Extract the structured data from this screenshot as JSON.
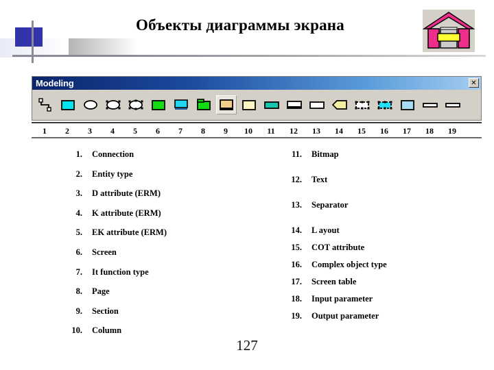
{
  "slide": {
    "title": "Объекты диаграммы экрана",
    "number": "127"
  },
  "logo": {
    "name": "house-logo",
    "roof_color": "#ee2d8c",
    "pillar_color": "#ee2d8c",
    "band_color": "#ffff33",
    "frame_color": "#000000",
    "background_color": "#d4d0c8"
  },
  "decoration": {
    "square_color": "#3333aa",
    "line_color": "#8a8a99"
  },
  "toolbar": {
    "title": "Modeling",
    "close_label": "✕",
    "background": "#d4d0c8",
    "titlebar_start": "#0a246a",
    "titlebar_end": "#a6cdf0",
    "selected_index": 9,
    "buttons": [
      {
        "n": "1",
        "icon": "connection-icon",
        "shape": "polyline"
      },
      {
        "n": "2",
        "icon": "entity-type-icon",
        "shape": "rect",
        "fill": "#00e5ee"
      },
      {
        "n": "3",
        "icon": "d-attribute-icon",
        "shape": "ellipse",
        "fill": "#ffffff"
      },
      {
        "n": "4",
        "icon": "k-attribute-icon",
        "shape": "ellipse-ticks",
        "fill": "#ffffff"
      },
      {
        "n": "5",
        "icon": "ek-attribute-icon",
        "shape": "ellipse-ticks2",
        "fill": "#ffffff"
      },
      {
        "n": "6",
        "icon": "screen-icon",
        "shape": "rect",
        "fill": "#11dd11"
      },
      {
        "n": "7",
        "icon": "it-function-type-icon",
        "shape": "rect-line",
        "fill": "#22d6f0"
      },
      {
        "n": "8",
        "icon": "page-icon",
        "shape": "rect-tab",
        "fill": "#11dd11"
      },
      {
        "n": "9",
        "icon": "section-icon",
        "shape": "rect-shadow",
        "fill": "#f0cf8a"
      },
      {
        "n": "10",
        "icon": "column-icon",
        "shape": "rect",
        "fill": "#fbf3c0"
      },
      {
        "n": "11",
        "icon": "bitmap-icon",
        "shape": "rect-wide",
        "fill": "#16c6b0"
      },
      {
        "n": "12",
        "icon": "text-icon",
        "shape": "rect-bar",
        "fill": "#ffffff"
      },
      {
        "n": "13",
        "icon": "separator-icon",
        "shape": "rect-wide",
        "fill": "#ffffff"
      },
      {
        "n": "14",
        "icon": "layout-icon",
        "shape": "pentagon",
        "fill": "#f2f0a0"
      },
      {
        "n": "15",
        "icon": "cot-attribute-icon",
        "shape": "dashed",
        "fill": "#ffffff"
      },
      {
        "n": "16",
        "icon": "complex-object-type-icon",
        "shape": "dashed",
        "fill": "#22e0f5"
      },
      {
        "n": "17",
        "icon": "screen-table-icon",
        "shape": "rect",
        "fill": "#a8dcf5"
      },
      {
        "n": "18",
        "icon": "input-parameter-icon",
        "shape": "bar",
        "fill": "#ffffff"
      },
      {
        "n": "19",
        "icon": "output-parameter-icon",
        "shape": "bar",
        "fill": "#ffffff"
      }
    ]
  },
  "legend": {
    "left": [
      {
        "num": "1.",
        "label": "Connection"
      },
      {
        "num": "2.",
        "label": "Entity type"
      },
      {
        "num": "3.",
        "label": "D attribute (ERM)"
      },
      {
        "num": "4.",
        "label": "K attribute (ERM)"
      },
      {
        "num": "5.",
        "label": "EK attribute (ERM)"
      },
      {
        "num": "6.",
        "label": "Screen"
      },
      {
        "num": "7.",
        "label": "It function type"
      },
      {
        "num": "8.",
        "label": "Page"
      },
      {
        "num": "9.",
        "label": "Section"
      },
      {
        "num": "10.",
        "label": "Column"
      }
    ],
    "right": [
      {
        "num": "11.",
        "label": "Bitmap"
      },
      {
        "num": "12.",
        "label": "Text"
      },
      {
        "num": "13.",
        "label": "Separator"
      },
      {
        "num": "14.",
        "label": "L ayout"
      },
      {
        "num": "15.",
        "label": "COT attribute"
      },
      {
        "num": "16.",
        "label": "Complex object type"
      },
      {
        "num": "17.",
        "label": "Screen table"
      },
      {
        "num": "18.",
        "label": "Input parameter"
      },
      {
        "num": "19.",
        "label": "Output parameter"
      }
    ]
  }
}
